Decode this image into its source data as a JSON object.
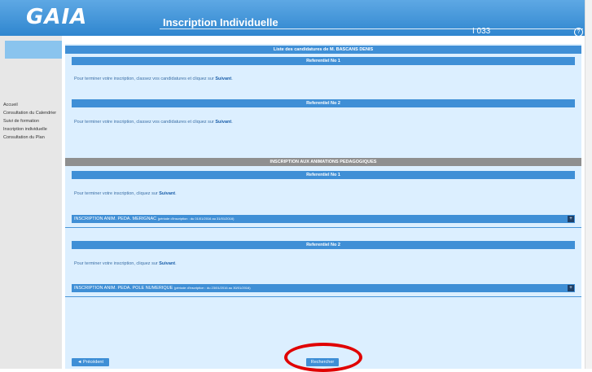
{
  "header": {
    "logo": "GAIA",
    "title": "Inscription Individuelle",
    "code": "I 033",
    "help_icon": "help-icon"
  },
  "sidebar": {
    "items": [
      {
        "label": "Accueil"
      },
      {
        "label": "Consultation du Calendrier"
      },
      {
        "label": "Suivi de formation"
      },
      {
        "label": "Inscription individuelle"
      },
      {
        "label": "Consultation du Plan"
      }
    ]
  },
  "main": {
    "candidatures_title": "Liste des candidatures de ",
    "candidat_name": "M. BASCANS DENIS",
    "ref1": "Referentiel No 1",
    "ref2": "Referentiel No 2",
    "msg_prefix": "Pour terminer votre inscription, classez vos candidatures et cliquez sur ",
    "msg_link": "Suivant",
    "msg_suffix": ".",
    "anim_title": "INSCRIPTION AUX ANIMATIONS PEDAGOGIQUES",
    "anim_ref1": "Referentiel No 1",
    "anim_ref2": "Referentiel No 2",
    "anim_msg_prefix": "Pour terminer votre inscription, cliquez sur ",
    "anim_msg_link": "Suivant",
    "anim_msg_suffix": ".",
    "row1_label": "INSCRIPTION ANIM. PEDA. MERIGNAC",
    "row1_period": "(période d'inscription : du 01/01/2016 au 31/01/2016)",
    "row2_label": "INSCRIPTION ANIM. PEDA. POLE NUMERIQUE",
    "row2_period": "(période d'inscription : du 23/01/2016 au 30/01/2016)",
    "expand_icon": "+"
  },
  "footer": {
    "prev_label": "◄ Précédent",
    "search_label": "Rechercher"
  },
  "colors": {
    "header": "#2f86cf",
    "bar": "#3f8fd6",
    "main_bg": "#dcefff",
    "highlight": "#e00000"
  }
}
